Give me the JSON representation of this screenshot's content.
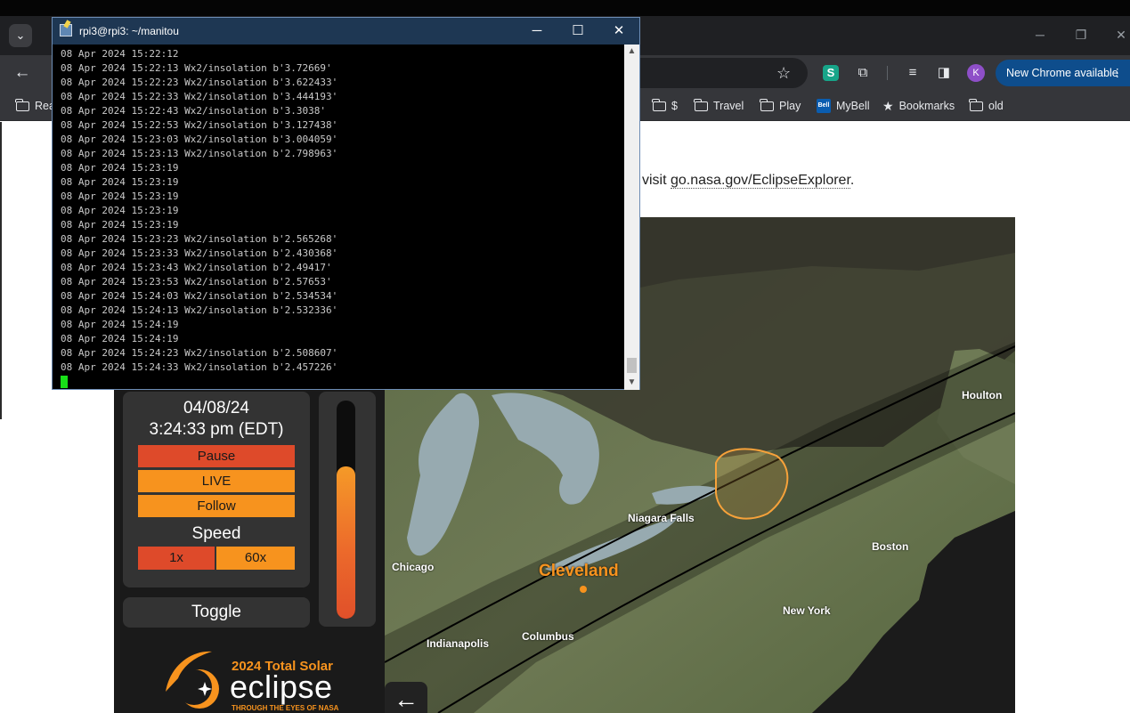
{
  "browser": {
    "bookmarks": [
      {
        "label": "Rea"
      },
      {
        "label": "$"
      },
      {
        "label": "Travel"
      },
      {
        "label": "Play"
      },
      {
        "label": "MyBell"
      },
      {
        "label": "Bookmarks"
      },
      {
        "label": "old"
      }
    ],
    "avatar_initial": "K",
    "extension_letter": "S",
    "update_button": "New Chrome available"
  },
  "page": {
    "intro_prefix": "visit ",
    "link_text": "go.nasa.gov/EclipseExplorer",
    "intro_suffix": "."
  },
  "eclipse_app": {
    "date": "04/08/24",
    "time": "3:24:33 pm (EDT)",
    "buttons": {
      "pause": "Pause",
      "live": "LIVE",
      "follow": "Follow"
    },
    "speed_label": "Speed",
    "speed_options": [
      "1x",
      "60x"
    ],
    "toggle": "Toggle",
    "meter_level": 0.7,
    "logo": {
      "year_title": "2024 Total Solar",
      "word": "eclipse",
      "tagline": "THROUGH THE EYES OF NASA"
    },
    "map_labels": {
      "houlton": "Houlton",
      "niagara": "Niagara Falls",
      "boston": "Boston",
      "chicago": "Chicago",
      "cleveland": "Cleveland",
      "new_york": "New York",
      "indianapolis": "Indianapolis",
      "columbus": "Columbus"
    },
    "colors": {
      "accent": "#f7931e",
      "pause": "#de4a2a"
    }
  },
  "terminal": {
    "title": "rpi3@rpi3: ~/manitou",
    "lines": [
      "08 Apr 2024 15:22:12",
      "08 Apr 2024 15:22:13 Wx2/insolation b'3.72669'",
      "08 Apr 2024 15:22:23 Wx2/insolation b'3.622433'",
      "08 Apr 2024 15:22:33 Wx2/insolation b'3.444193'",
      "08 Apr 2024 15:22:43 Wx2/insolation b'3.3038'",
      "08 Apr 2024 15:22:53 Wx2/insolation b'3.127438'",
      "08 Apr 2024 15:23:03 Wx2/insolation b'3.004059'",
      "08 Apr 2024 15:23:13 Wx2/insolation b'2.798963'",
      "08 Apr 2024 15:23:19",
      "08 Apr 2024 15:23:19",
      "08 Apr 2024 15:23:19",
      "08 Apr 2024 15:23:19",
      "08 Apr 2024 15:23:19",
      "08 Apr 2024 15:23:23 Wx2/insolation b'2.565268'",
      "08 Apr 2024 15:23:33 Wx2/insolation b'2.430368'",
      "08 Apr 2024 15:23:43 Wx2/insolation b'2.49417'",
      "08 Apr 2024 15:23:53 Wx2/insolation b'2.57653'",
      "08 Apr 2024 15:24:03 Wx2/insolation b'2.534534'",
      "08 Apr 2024 15:24:13 Wx2/insolation b'2.532336'",
      "08 Apr 2024 15:24:19",
      "08 Apr 2024 15:24:19",
      "08 Apr 2024 15:24:23 Wx2/insolation b'2.508607'",
      "08 Apr 2024 15:24:33 Wx2/insolation b'2.457226'"
    ]
  }
}
